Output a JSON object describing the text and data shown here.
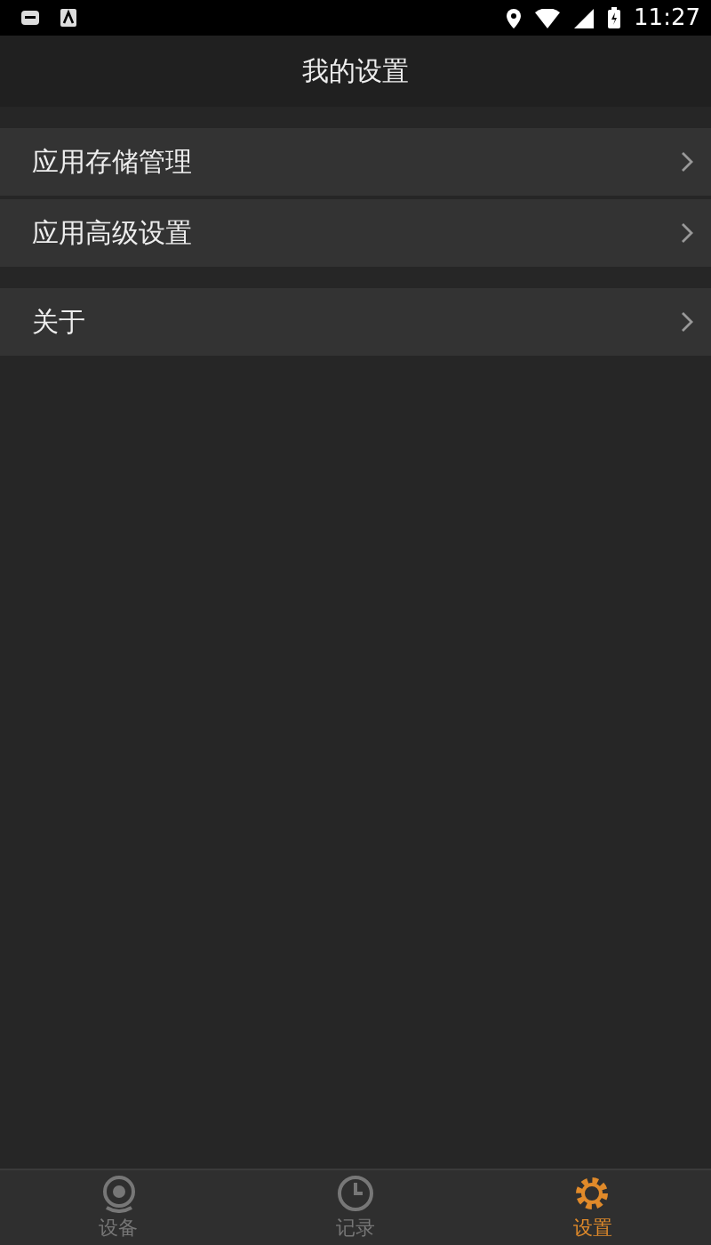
{
  "status_bar": {
    "time": "11:27"
  },
  "title": "我的设置",
  "sections": [
    {
      "items": [
        {
          "label": "应用存储管理"
        },
        {
          "label": "应用高级设置"
        }
      ]
    },
    {
      "items": [
        {
          "label": "关于"
        }
      ]
    }
  ],
  "bottom_nav": [
    {
      "label": "设备",
      "selected": false
    },
    {
      "label": "记录",
      "selected": false
    },
    {
      "label": "设置",
      "selected": true
    }
  ]
}
